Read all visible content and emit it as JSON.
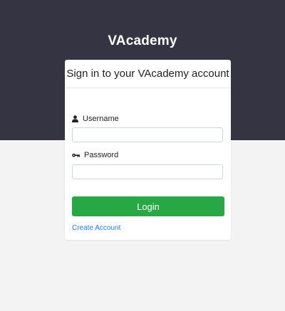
{
  "brand": {
    "title": "VAcademy"
  },
  "card": {
    "title": "Sign in to your VAcademy account",
    "username": {
      "label": "Username",
      "icon": "user-icon",
      "value": "",
      "placeholder": ""
    },
    "password": {
      "label": "Password",
      "icon": "key-icon",
      "value": "",
      "placeholder": ""
    },
    "login_label": "Login",
    "create_account_label": "Create Account"
  },
  "colors": {
    "header_bg": "#343443",
    "page_bg": "#f3f3f3",
    "login_button": "#28a745",
    "link": "#1d7cf2"
  }
}
